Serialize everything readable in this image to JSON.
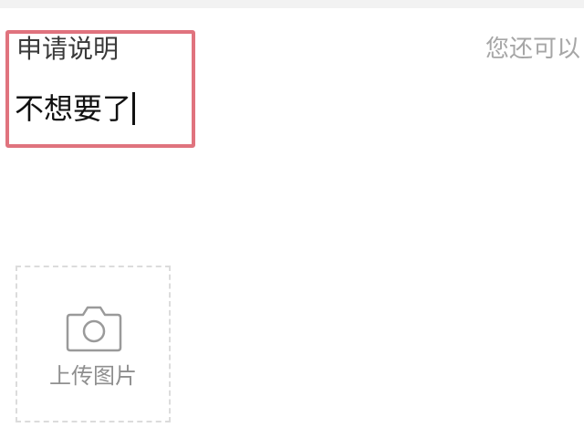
{
  "form": {
    "section_label": "申请说明",
    "remaining_hint": "您还可以",
    "explanation_value": "不想要了",
    "focus_color": "#e0737e"
  },
  "upload": {
    "label": "上传图片",
    "icon": "camera-icon"
  }
}
